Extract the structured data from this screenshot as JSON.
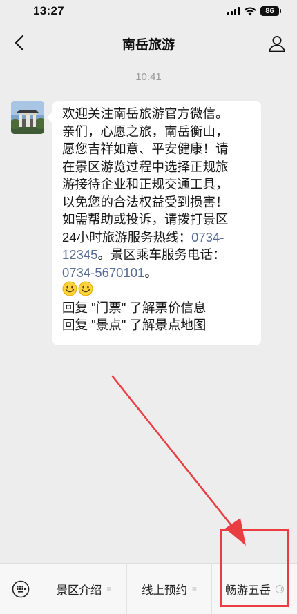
{
  "status_bar": {
    "time": "13:27",
    "battery": "86",
    "icons": [
      "signal-icon",
      "wifi-icon",
      "battery-icon"
    ]
  },
  "header": {
    "title": "南岳旅游",
    "back_icon": "chevron-left-icon",
    "profile_icon": "person-icon"
  },
  "chat": {
    "timestamp": "10:41",
    "message": {
      "lines": [
        "欢迎关注南岳旅游官方微信。",
        "亲们，心愿之旅，南岳衡山，",
        "愿您吉祥如意、平安健康！请",
        "在景区游览过程中选择正规旅",
        "游接待企业和正规交通工具，",
        "以免您的合法权益受到损害！",
        "如需帮助或投诉，请拨打景区",
        "24小时旅游服务热线："
      ],
      "hotline_part1": "0734-",
      "hotline_part2": "12345",
      "after_hotline": "。景区乘车服务电话：",
      "shuttle_phone": "0734-5670101",
      "after_shuttle": "。",
      "emoji": "smile-emoji",
      "reply_lines": [
        "回复 \"门票\" 了解票价信息",
        "回复 \"景点\" 了解景点地图"
      ]
    }
  },
  "menu": {
    "keyboard_icon": "keyboard-icon",
    "items": [
      {
        "label": "景区介绍",
        "icon": "menu-list-icon"
      },
      {
        "label": "线上预约",
        "icon": "menu-list-icon"
      },
      {
        "label": "畅游五岳",
        "icon": "link-icon"
      }
    ]
  },
  "colors": {
    "background": "#ededed",
    "link": "#576b95",
    "annotation": "#ea3d41"
  }
}
